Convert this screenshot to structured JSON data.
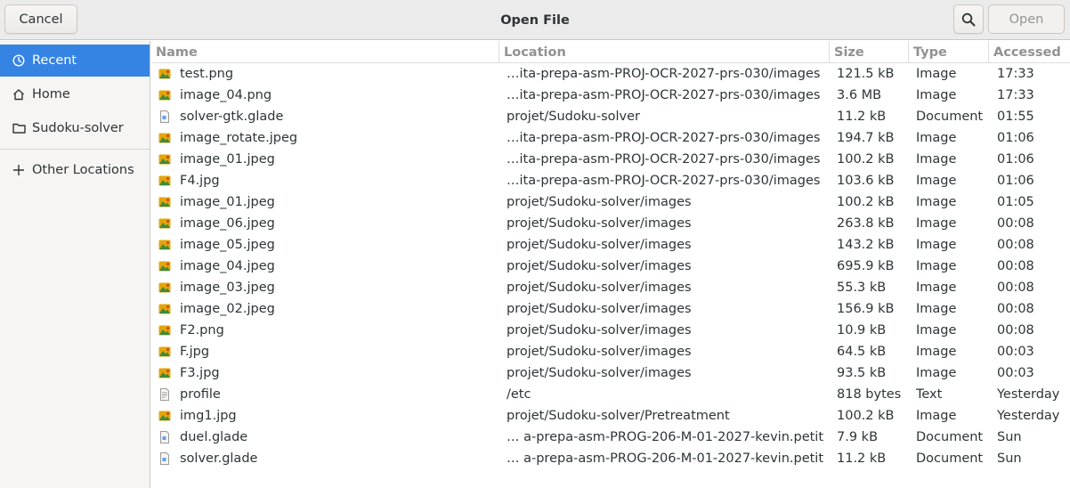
{
  "header": {
    "title": "Open File",
    "cancel_label": "Cancel",
    "open_label": "Open"
  },
  "sidebar": {
    "items": [
      {
        "label": "Recent",
        "icon": "clock-icon"
      },
      {
        "label": "Home",
        "icon": "home-icon"
      },
      {
        "label": "Sudoku-solver",
        "icon": "folder-icon"
      },
      {
        "label": "Other Locations",
        "icon": "plus-icon"
      }
    ]
  },
  "columns": [
    "Name",
    "Location",
    "Size",
    "Type",
    "Accessed"
  ],
  "files": [
    {
      "name": "test.png",
      "location": "…ita-prepa-asm-PROJ-OCR-2027-prs-030/images",
      "size": "121.5 kB",
      "type": "Image",
      "accessed": "17:33",
      "icon": "image-file-icon"
    },
    {
      "name": "image_04.png",
      "location": "…ita-prepa-asm-PROJ-OCR-2027-prs-030/images",
      "size": "3.6 MB",
      "type": "Image",
      "accessed": "17:33",
      "icon": "image-file-icon"
    },
    {
      "name": "solver-gtk.glade",
      "location": "projet/Sudoku-solver",
      "size": "11.2 kB",
      "type": "Document",
      "accessed": "01:55",
      "icon": "document-file-icon"
    },
    {
      "name": "image_rotate.jpeg",
      "location": "…ita-prepa-asm-PROJ-OCR-2027-prs-030/images",
      "size": "194.7 kB",
      "type": "Image",
      "accessed": "01:06",
      "icon": "image-file-icon"
    },
    {
      "name": "image_01.jpeg",
      "location": "…ita-prepa-asm-PROJ-OCR-2027-prs-030/images",
      "size": "100.2 kB",
      "type": "Image",
      "accessed": "01:06",
      "icon": "image-file-icon"
    },
    {
      "name": "F4.jpg",
      "location": "…ita-prepa-asm-PROJ-OCR-2027-prs-030/images",
      "size": "103.6 kB",
      "type": "Image",
      "accessed": "01:06",
      "icon": "image-file-icon"
    },
    {
      "name": "image_01.jpeg",
      "location": "projet/Sudoku-solver/images",
      "size": "100.2 kB",
      "type": "Image",
      "accessed": "01:05",
      "icon": "image-file-icon"
    },
    {
      "name": "image_06.jpeg",
      "location": "projet/Sudoku-solver/images",
      "size": "263.8 kB",
      "type": "Image",
      "accessed": "00:08",
      "icon": "image-file-icon"
    },
    {
      "name": "image_05.jpeg",
      "location": "projet/Sudoku-solver/images",
      "size": "143.2 kB",
      "type": "Image",
      "accessed": "00:08",
      "icon": "image-file-icon"
    },
    {
      "name": "image_04.jpeg",
      "location": "projet/Sudoku-solver/images",
      "size": "695.9 kB",
      "type": "Image",
      "accessed": "00:08",
      "icon": "image-file-icon"
    },
    {
      "name": "image_03.jpeg",
      "location": "projet/Sudoku-solver/images",
      "size": "55.3 kB",
      "type": "Image",
      "accessed": "00:08",
      "icon": "image-file-icon"
    },
    {
      "name": "image_02.jpeg",
      "location": "projet/Sudoku-solver/images",
      "size": "156.9 kB",
      "type": "Image",
      "accessed": "00:08",
      "icon": "image-file-icon"
    },
    {
      "name": "F2.png",
      "location": "projet/Sudoku-solver/images",
      "size": "10.9 kB",
      "type": "Image",
      "accessed": "00:08",
      "icon": "image-file-icon"
    },
    {
      "name": "F.jpg",
      "location": "projet/Sudoku-solver/images",
      "size": "64.5 kB",
      "type": "Image",
      "accessed": "00:03",
      "icon": "image-file-icon"
    },
    {
      "name": "F3.jpg",
      "location": "projet/Sudoku-solver/images",
      "size": "93.5 kB",
      "type": "Image",
      "accessed": "00:03",
      "icon": "image-file-icon"
    },
    {
      "name": "profile",
      "location": "/etc",
      "size": "818 bytes",
      "type": "Text",
      "accessed": "Yesterday",
      "icon": "text-file-icon"
    },
    {
      "name": "img1.jpg",
      "location": "projet/Sudoku-solver/Pretreatment",
      "size": "100.2 kB",
      "type": "Image",
      "accessed": "Yesterday",
      "icon": "image-file-icon"
    },
    {
      "name": "duel.glade",
      "location": "… a-prepa-asm-PROG-206-M-01-2027-kevin.petit",
      "size": "7.9 kB",
      "type": "Document",
      "accessed": "Sun",
      "icon": "document-file-icon"
    },
    {
      "name": "solver.glade",
      "location": "… a-prepa-asm-PROG-206-M-01-2027-kevin.petit",
      "size": "11.2 kB",
      "type": "Document",
      "accessed": "Sun",
      "icon": "document-file-icon"
    }
  ],
  "colors": {
    "accent": "#3584e4",
    "header_bg": "#ebebeb",
    "sidebar_bg": "#f6f5f4"
  }
}
